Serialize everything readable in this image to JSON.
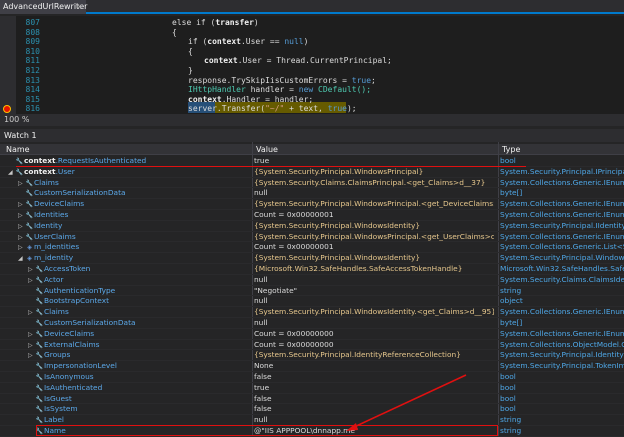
{
  "tab": {
    "title": "AdvancedUrlRewriter",
    "close": "×"
  },
  "code_lines": [
    {
      "num": "807",
      "indent": 0,
      "tokens": [
        {
          "t": "else if (",
          "c": "kw2"
        },
        {
          "t": "transfer",
          "c": "bold"
        },
        {
          "t": ")",
          "c": "pr"
        }
      ]
    },
    {
      "num": "808",
      "indent": 0,
      "tokens": [
        {
          "t": "{",
          "c": "pr"
        }
      ]
    },
    {
      "num": "809",
      "indent": 2,
      "tokens": [
        {
          "t": "if (",
          "c": "kw2"
        },
        {
          "t": "context",
          "c": "bold"
        },
        {
          "t": ".User == ",
          "c": "pr"
        },
        {
          "t": "null",
          "c": "kw"
        },
        {
          "t": ")",
          "c": "pr"
        }
      ]
    },
    {
      "num": "810",
      "indent": 2,
      "tokens": [
        {
          "t": "{",
          "c": "pr"
        }
      ]
    },
    {
      "num": "811",
      "indent": 4,
      "tokens": [
        {
          "t": "context",
          "c": "bold"
        },
        {
          "t": ".User = Thread.CurrentPrincipal;",
          "c": "pr"
        }
      ]
    },
    {
      "num": "812",
      "indent": 2,
      "tokens": [
        {
          "t": "}",
          "c": "pr"
        }
      ]
    },
    {
      "num": "813",
      "indent": 2,
      "tokens": [
        {
          "t": "response",
          "c": "pr"
        },
        {
          "t": ".TrySkipIisCustomErrors = ",
          "c": "pr"
        },
        {
          "t": "true",
          "c": "kw"
        },
        {
          "t": ";",
          "c": "pr"
        }
      ]
    },
    {
      "num": "814",
      "indent": 2,
      "tokens": [
        {
          "t": "IHttpHandler",
          "c": "ty"
        },
        {
          "t": " handler = ",
          "c": "pr"
        },
        {
          "t": "new",
          "c": "kw"
        },
        {
          "t": " CDefault();",
          "c": "ty"
        }
      ]
    },
    {
      "num": "815",
      "indent": 2,
      "tokens": [
        {
          "t": "context",
          "c": "bold"
        },
        {
          "t": ".Handler = handler;",
          "c": "pr"
        }
      ]
    },
    {
      "num": "816",
      "indent": 2,
      "tokens": [
        {
          "t": "server",
          "c": "pr"
        },
        {
          "t": ".Transfer(",
          "c": "pr"
        },
        {
          "t": "\"~/\"",
          "c": "st"
        },
        {
          "t": " + text, ",
          "c": "pr"
        },
        {
          "t": "true",
          "c": "kw"
        },
        {
          "t": ");",
          "c": "pr"
        }
      ]
    }
  ],
  "zoom": "100 %",
  "watch": {
    "title": "Watch 1",
    "columns": {
      "name": "Name",
      "value": "Value",
      "type": "Type"
    },
    "rows": [
      {
        "depth": 0,
        "exp": "",
        "icon": "wrench",
        "name_bold": "context",
        "name_rest": ".RequestIsAuthenticated",
        "value": "true",
        "vclass": "vs",
        "type": "bool"
      },
      {
        "depth": 0,
        "exp": "◢",
        "icon": "wrench",
        "name_bold": "context",
        "name_rest": ".User",
        "value": "{System.Security.Principal.WindowsPrincipal}",
        "vclass": "brk",
        "type": "System.Security.Principal.IPrincipal..."
      },
      {
        "depth": 1,
        "exp": "▷",
        "icon": "wrench",
        "name_bold": "",
        "name_rest": "Claims",
        "value": "{System.Security.Claims.ClaimsPrincipal.<get_Claims>d__37}",
        "vclass": "brk",
        "type": "System.Collections.Generic.IEnume..."
      },
      {
        "depth": 1,
        "exp": "",
        "icon": "wrench",
        "name_bold": "",
        "name_rest": "CustomSerializationData",
        "value": "null",
        "vclass": "vs",
        "type": "byte[]"
      },
      {
        "depth": 1,
        "exp": "▷",
        "icon": "wrench",
        "name_bold": "",
        "name_rest": "DeviceClaims",
        "value": "{System.Security.Principal.WindowsPrincipal.<get_DeviceClaims>d__13}",
        "vclass": "brk",
        "type": "System.Collections.Generic.IEnume..."
      },
      {
        "depth": 1,
        "exp": "▷",
        "icon": "wrench",
        "name_bold": "",
        "name_rest": "Identities",
        "value": "Count = 0x00000001",
        "vclass": "vs",
        "type": "System.Collections.Generic.IEnume..."
      },
      {
        "depth": 1,
        "exp": "▷",
        "icon": "wrench",
        "name_bold": "",
        "name_rest": "Identity",
        "value": "{System.Security.Principal.WindowsIdentity}",
        "vclass": "brk",
        "type": "System.Security.Principal.IIdentity {..."
      },
      {
        "depth": 1,
        "exp": "▷",
        "icon": "wrench",
        "name_bold": "",
        "name_rest": "UserClaims",
        "value": "{System.Security.Principal.WindowsPrincipal.<get_UserClaims>d__11}",
        "vclass": "brk",
        "type": "System.Collections.Generic.IEnume..."
      },
      {
        "depth": 1,
        "exp": "▷",
        "icon": "field",
        "name_bold": "",
        "name_rest": "m_identities",
        "value": "Count = 0x00000001",
        "vclass": "vs",
        "type": "System.Collections.Generic.List<Sy..."
      },
      {
        "depth": 1,
        "exp": "◢",
        "icon": "field",
        "name_bold": "",
        "name_rest": "m_identity",
        "value": "{System.Security.Principal.WindowsIdentity}",
        "vclass": "brk",
        "type": "System.Security.Principal.Windows..."
      },
      {
        "depth": 2,
        "exp": "▷",
        "icon": "wrench",
        "name_bold": "",
        "name_rest": "AccessToken",
        "value": "{Microsoft.Win32.SafeHandles.SafeAccessTokenHandle}",
        "vclass": "brk",
        "type": "Microsoft.Win32.SafeHandles.SafeA..."
      },
      {
        "depth": 2,
        "exp": "▷",
        "icon": "wrench",
        "name_bold": "",
        "name_rest": "Actor",
        "value": "null",
        "vclass": "vs",
        "type": "System.Security.Claims.ClaimsIden..."
      },
      {
        "depth": 2,
        "exp": "",
        "icon": "wrench",
        "name_bold": "",
        "name_rest": "AuthenticationType",
        "value": "\"Negotiate\"",
        "vclass": "vs",
        "type": "string"
      },
      {
        "depth": 2,
        "exp": "",
        "icon": "wrench",
        "name_bold": "",
        "name_rest": "BootstrapContext",
        "value": "null",
        "vclass": "vs",
        "type": "object"
      },
      {
        "depth": 2,
        "exp": "▷",
        "icon": "wrench",
        "name_bold": "",
        "name_rest": "Claims",
        "value": "{System.Security.Principal.WindowsIdentity.<get_Claims>d__95}",
        "vclass": "brk",
        "type": "System.Collections.Generic.IEnume..."
      },
      {
        "depth": 2,
        "exp": "",
        "icon": "wrench",
        "name_bold": "",
        "name_rest": "CustomSerializationData",
        "value": "null",
        "vclass": "vs",
        "type": "byte[]"
      },
      {
        "depth": 2,
        "exp": "▷",
        "icon": "wrench",
        "name_bold": "",
        "name_rest": "DeviceClaims",
        "value": "Count = 0x00000000",
        "vclass": "vs",
        "type": "System.Collections.Generic.IEnume..."
      },
      {
        "depth": 2,
        "exp": "▷",
        "icon": "wrench",
        "name_bold": "",
        "name_rest": "ExternalClaims",
        "value": "Count = 0x00000000",
        "vclass": "vs",
        "type": "System.Collections.ObjectModel.C..."
      },
      {
        "depth": 2,
        "exp": "▷",
        "icon": "wrench",
        "name_bold": "",
        "name_rest": "Groups",
        "value": "{System.Security.Principal.IdentityReferenceCollection}",
        "vclass": "brk",
        "type": "System.Security.Principal.IdentityR..."
      },
      {
        "depth": 2,
        "exp": "",
        "icon": "wrench",
        "name_bold": "",
        "name_rest": "ImpersonationLevel",
        "value": "None",
        "vclass": "vs",
        "type": "System.Security.Principal.TokenIm..."
      },
      {
        "depth": 2,
        "exp": "",
        "icon": "wrench",
        "name_bold": "",
        "name_rest": "IsAnonymous",
        "value": "false",
        "vclass": "vs",
        "type": "bool"
      },
      {
        "depth": 2,
        "exp": "",
        "icon": "wrench",
        "name_bold": "",
        "name_rest": "IsAuthenticated",
        "value": "true",
        "vclass": "vs",
        "type": "bool"
      },
      {
        "depth": 2,
        "exp": "",
        "icon": "wrench",
        "name_bold": "",
        "name_rest": "IsGuest",
        "value": "false",
        "vclass": "vs",
        "type": "bool"
      },
      {
        "depth": 2,
        "exp": "",
        "icon": "wrench",
        "name_bold": "",
        "name_rest": "IsSystem",
        "value": "false",
        "vclass": "vs",
        "type": "bool"
      },
      {
        "depth": 2,
        "exp": "",
        "icon": "wrench",
        "name_bold": "",
        "name_rest": "Label",
        "value": "null",
        "vclass": "vs",
        "type": "string"
      },
      {
        "depth": 2,
        "exp": "",
        "icon": "wrench",
        "name_bold": "",
        "name_rest": "Name",
        "value": "@\"IIS APPPOOL\\dnnapp.me\"",
        "vclass": "vs",
        "type": "string"
      }
    ]
  },
  "colors": {
    "accent": "#007acc",
    "annotation": "#e01010",
    "identifier": "#5ca9ea"
  }
}
